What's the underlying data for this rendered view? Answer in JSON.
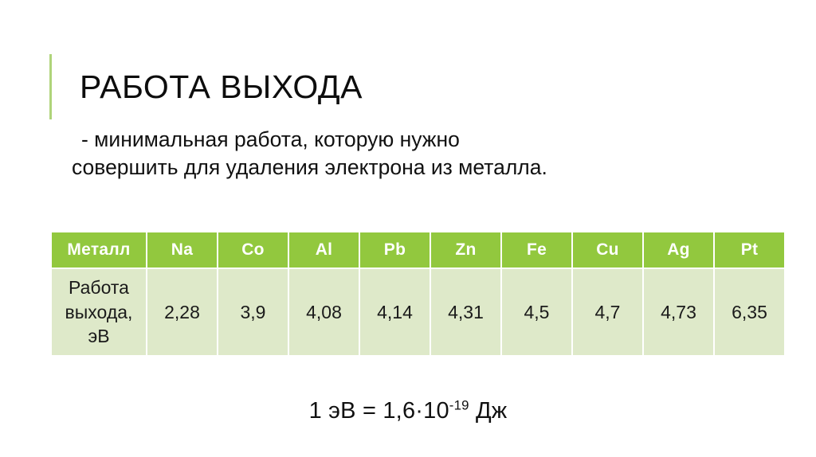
{
  "slide": {
    "title": "РАБОТА ВЫХОДА",
    "accent_color": "#AFD47A",
    "subtitle_line_1": "- минимальная работа, которую нужно",
    "subtitle_line_2": "совершить для удаления электрона из металла."
  },
  "table": {
    "header_bg": "#92C83E",
    "header_text_color": "#FFFFFF",
    "body_bg": "#DEE9C9",
    "headers": [
      "Металл",
      "Na",
      "Co",
      "Al",
      "Pb",
      "Zn",
      "Fe",
      "Cu",
      "Ag",
      "Pt"
    ],
    "row_label": "Работа выхода, эВ",
    "row_label_lines": [
      "Работа",
      "выхода,",
      "эВ"
    ],
    "values": [
      "2,28",
      "3,9",
      "4,08",
      "4,14",
      "4,31",
      "4,5",
      "4,7",
      "4,73",
      "6,35"
    ]
  },
  "formula": {
    "base": "1 эВ = 1,6·10",
    "exponent": "-19",
    "unit": " Дж"
  },
  "chart_data": {
    "type": "table",
    "title": "Работа выхода",
    "categories": [
      "Na",
      "Co",
      "Al",
      "Pb",
      "Zn",
      "Fe",
      "Cu",
      "Ag",
      "Pt"
    ],
    "values": [
      2.28,
      3.9,
      4.08,
      4.14,
      4.31,
      4.5,
      4.7,
      4.73,
      6.35
    ],
    "xlabel": "Металл",
    "ylabel": "Работа выхода, эВ",
    "unit": "эВ"
  }
}
